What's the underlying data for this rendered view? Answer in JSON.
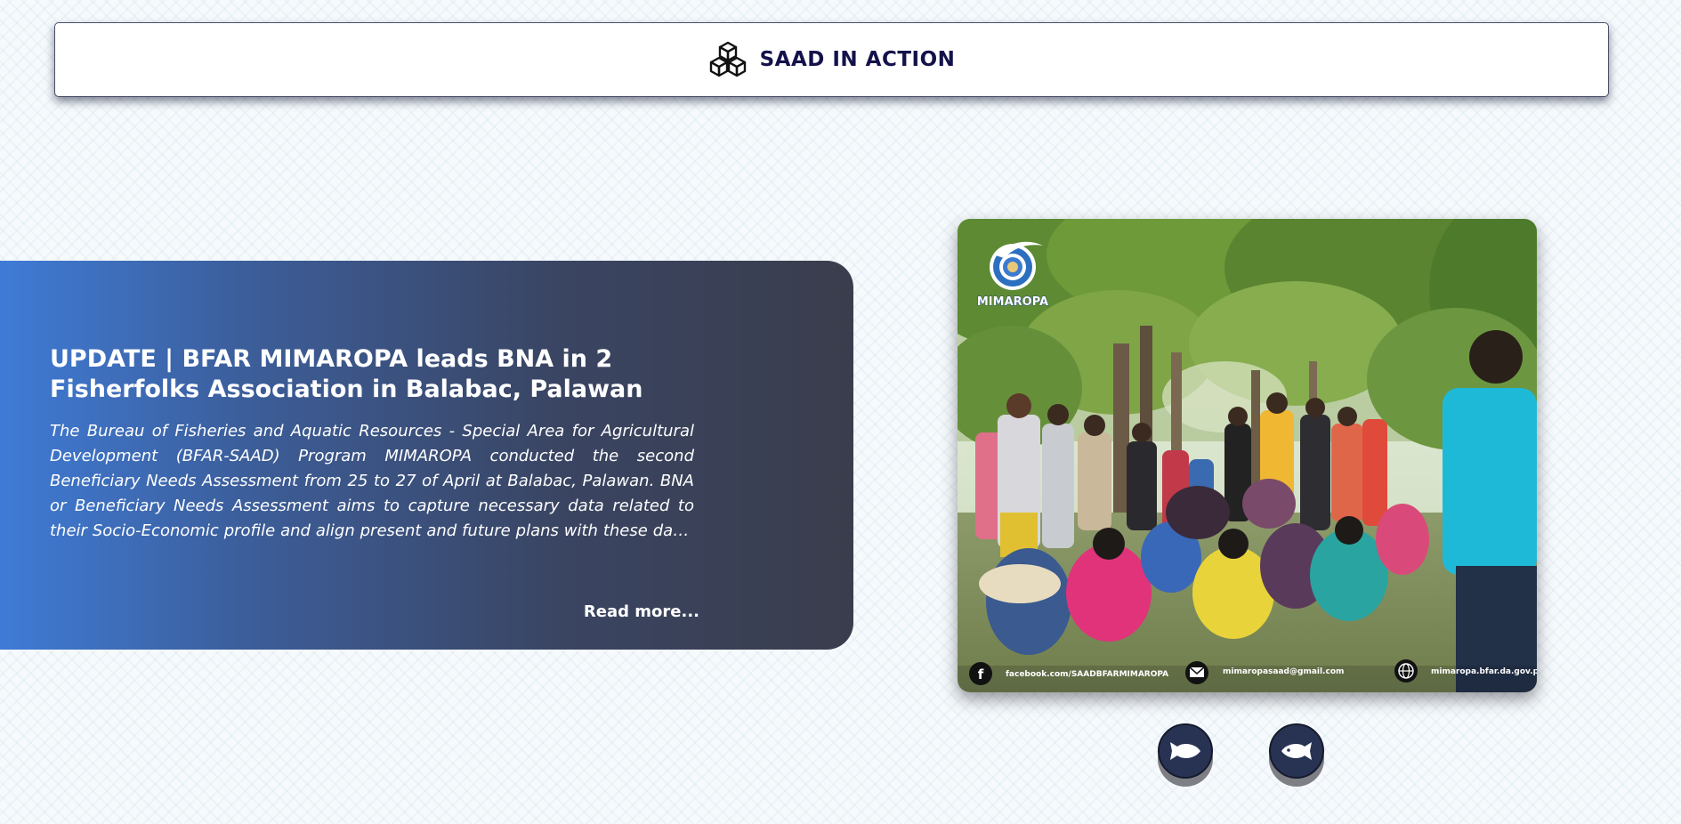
{
  "header": {
    "title": "SAAD IN ACTION",
    "icon": "cubes-icon"
  },
  "article": {
    "title": "UPDATE | BFAR MIMAROPA leads BNA in 2 Fisherfolks Association in Balabac, Palawan",
    "body": "The Bureau of Fisheries and Aquatic Resources - Special Area for Agricultural Development (BFAR-SAAD) Program MIMAROPA conducted the second Beneficiary Needs Assessment from 25 to 27 of April at Balabac, Palawan. BNA or Beneficiary Needs Assessment aims to capture necessary data related to their Socio-Economic profile and align present and future plans with these data. It emphasizes validation of consistency of data acquired from the qualified beneficiaries using",
    "read_more": "Read more..."
  },
  "photo": {
    "logo_text": "MIMAROPA",
    "footer": {
      "facebook": "facebook.com/SAADBFARMIMAROPA",
      "email": "mimaropasaad@gmail.com",
      "website": "mimaropa.bfar.da.gov.ph"
    }
  },
  "carousel": {
    "prev_icon": "fish-left-icon",
    "next_icon": "fish-right-icon"
  },
  "colors": {
    "header_text": "#14124a",
    "card_gradient_start": "#3f7bd6",
    "card_gradient_end": "#3a3d4c",
    "nav_button": "#283354"
  }
}
